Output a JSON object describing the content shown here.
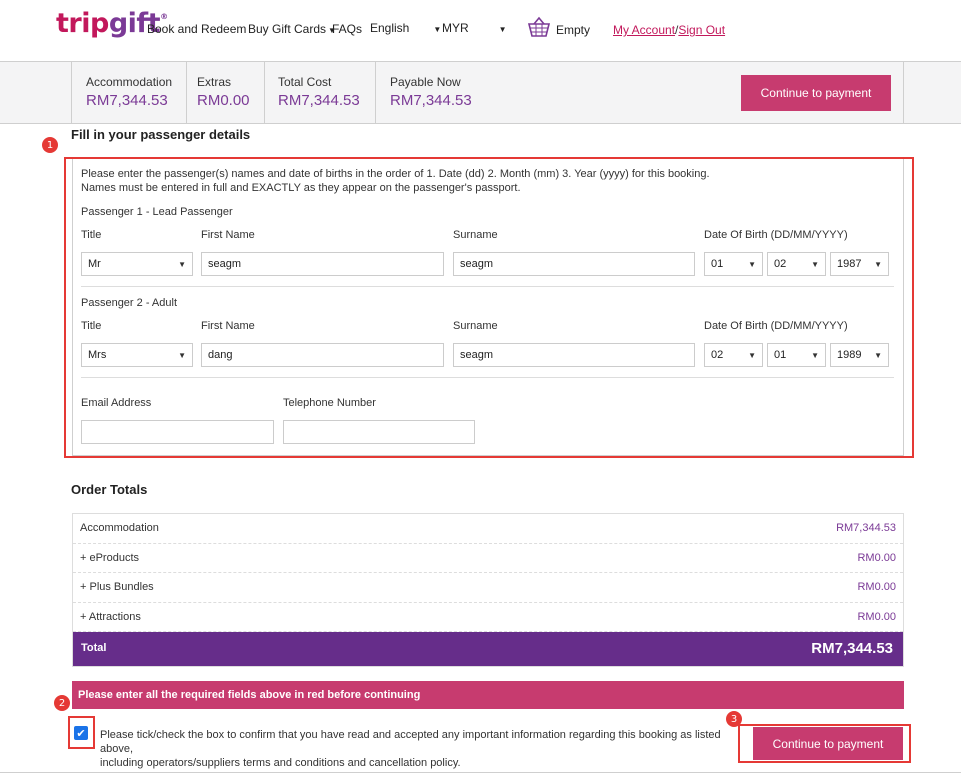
{
  "header": {
    "logo_part1": "trip",
    "logo_part2": "gift",
    "logo_mark": "®",
    "nav": {
      "book_redeem": "Book and Redeem",
      "gift_cards": "Buy Gift Cards",
      "faqs": "FAQs",
      "language": "English",
      "currency": "MYR"
    },
    "basket_label": "Empty",
    "basket_icon": "basket-icon",
    "my_account": "My Account",
    "separator": "/",
    "sign_out": "Sign Out"
  },
  "summary": {
    "accommodation_label": "Accommodation",
    "accommodation_value": "RM7,344.53",
    "extras_label": "Extras",
    "extras_value": "RM0.00",
    "total_cost_label": "Total Cost",
    "total_cost_value": "RM7,344.53",
    "payable_label": "Payable Now",
    "payable_value": "RM7,344.53",
    "continue_label": "Continue to payment"
  },
  "passenger": {
    "title": "Fill in your passenger details",
    "instruction_line1": "Please enter the passenger(s) names and date of births in the order of 1. Date (dd) 2. Month (mm) 3. Year (yyyy) for this booking.",
    "instruction_line2": "Names must be entered in full and EXACTLY as they appear on the passenger's passport.",
    "labels": {
      "title": "Title",
      "first_name": "First Name",
      "surname": "Surname",
      "dob": "Date Of Birth (DD/MM/YYYY)",
      "email": "Email Address",
      "phone": "Telephone Number"
    },
    "pax1": {
      "heading": "Passenger 1 - Lead Passenger",
      "title": "Mr",
      "first_name": "seagm",
      "surname": "seagm",
      "dob_day": "01",
      "dob_month": "02",
      "dob_year": "1987"
    },
    "pax2": {
      "heading": "Passenger 2 - Adult",
      "title": "Mrs",
      "first_name": "dang",
      "surname": "seagm",
      "dob_day": "02",
      "dob_month": "01",
      "dob_year": "1989"
    },
    "email": "",
    "phone": ""
  },
  "totals": {
    "title": "Order Totals",
    "rows": [
      {
        "label": "Accommodation",
        "value": "RM7,344.53"
      },
      {
        "label": "+ eProducts",
        "value": "RM0.00"
      },
      {
        "label": "+ Plus Bundles",
        "value": "RM0.00"
      },
      {
        "label": "+ Attractions",
        "value": "RM0.00"
      }
    ],
    "total_label": "Total",
    "total_value": "RM7,344.53"
  },
  "warning": "Please enter all the required fields above in red before continuing",
  "confirm_line1": "Please tick/check the box to confirm that you have read and accepted any important information regarding this booking as listed above,",
  "confirm_line2": "including operators/suppliers terms and conditions and cancellation policy.",
  "bottom_continue_label": "Continue to payment",
  "markers": [
    "1",
    "2",
    "3"
  ],
  "colors": {
    "brand_pink": "#c73b6f",
    "brand_purple": "#662d8a",
    "price_purple": "#7b3a96",
    "annotation_red": "#e53935"
  }
}
